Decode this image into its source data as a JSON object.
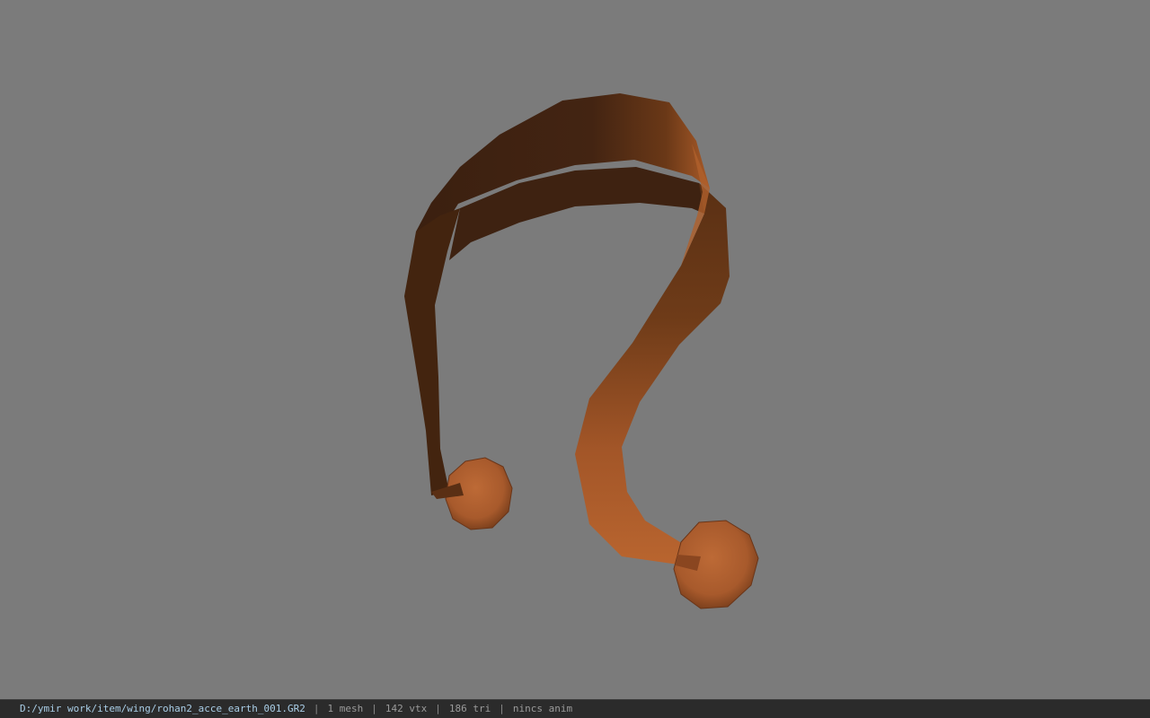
{
  "viewport": {
    "model": "rohan2_acce_earth_001",
    "background_color": "#7b7b7b"
  },
  "status_bar": {
    "file_path": "D:/ymir work/item/wing/rohan2_acce_earth_001.GR2",
    "separator": "|",
    "mesh_count": "1 mesh",
    "vertex_count": "142 vtx",
    "triangle_count": "186 tri",
    "anim_status": "nincs anim"
  },
  "colors": {
    "band_dark": "#3f2312",
    "band_mid": "#6a3a18",
    "band_light": "#b5632f",
    "bead": "#b36232",
    "bead_shadow": "#7a3f1c"
  }
}
